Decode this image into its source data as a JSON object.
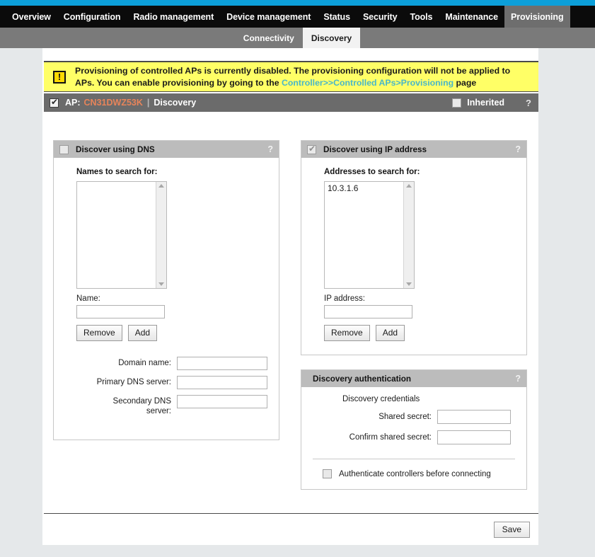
{
  "theme": {
    "accent": "#0c9fd9",
    "nav_bg": "#0b0b0b",
    "subnav_bg": "#7a7a7a",
    "active_tab_bg": "#6e6e6e",
    "alert_bg": "#ffff66",
    "alert_link": "#49b6c9",
    "ap_header_bg": "#6b6b6b",
    "ap_id_color": "#e8845a",
    "panel_head_bg": "#bcbcbc",
    "page_bg": "#e5e8ea"
  },
  "mainnav": {
    "items": [
      {
        "label": "Overview",
        "active": false
      },
      {
        "label": "Configuration",
        "active": false
      },
      {
        "label": "Radio management",
        "active": false
      },
      {
        "label": "Device management",
        "active": false
      },
      {
        "label": "Status",
        "active": false
      },
      {
        "label": "Security",
        "active": false
      },
      {
        "label": "Tools",
        "active": false
      },
      {
        "label": "Maintenance",
        "active": false
      },
      {
        "label": "Provisioning",
        "active": true
      }
    ]
  },
  "subnav": {
    "items": [
      {
        "label": "Connectivity",
        "active": false
      },
      {
        "label": "Discovery",
        "active": true
      }
    ]
  },
  "alert": {
    "icon": "warning-exclamation-icon",
    "text_before": "Provisioning of controlled APs is currently disabled. The provisioning configuration will not be applied to APs. You can enable provisioning by going to the ",
    "link": "Controller>>Controlled APs>Provisioning",
    "text_after": " page"
  },
  "ap_header": {
    "checkbox_checked": true,
    "prefix": "AP:",
    "ap_id": "CN31DWZ53K",
    "separator": "|",
    "section": "Discovery",
    "inherited_label": "Inherited",
    "inherited_checked": false,
    "help": "?"
  },
  "dns_panel": {
    "title": "Discover using DNS",
    "enabled": false,
    "help": "?",
    "names_label": "Names to search for:",
    "names": [],
    "name_field_label": "Name:",
    "name_value": "",
    "remove_label": "Remove",
    "add_label": "Add",
    "rows": [
      {
        "label": "Domain name:",
        "value": ""
      },
      {
        "label": "Primary DNS server:",
        "value": ""
      },
      {
        "label": "Secondary DNS server:",
        "value": ""
      }
    ]
  },
  "ip_panel": {
    "title": "Discover using IP address",
    "enabled": true,
    "help": "?",
    "addresses_label": "Addresses to search for:",
    "addresses": [
      "10.3.1.6"
    ],
    "ip_field_label": "IP address:",
    "ip_value": "",
    "remove_label": "Remove",
    "add_label": "Add"
  },
  "auth_panel": {
    "title": "Discovery authentication",
    "help": "?",
    "credentials_label": "Discovery credentials",
    "shared_secret_label": "Shared secret:",
    "shared_secret_value": "",
    "confirm_secret_label": "Confirm shared secret:",
    "confirm_secret_value": "",
    "authenticate_label": "Authenticate controllers before connecting",
    "authenticate_checked": false
  },
  "footer": {
    "save_label": "Save"
  }
}
